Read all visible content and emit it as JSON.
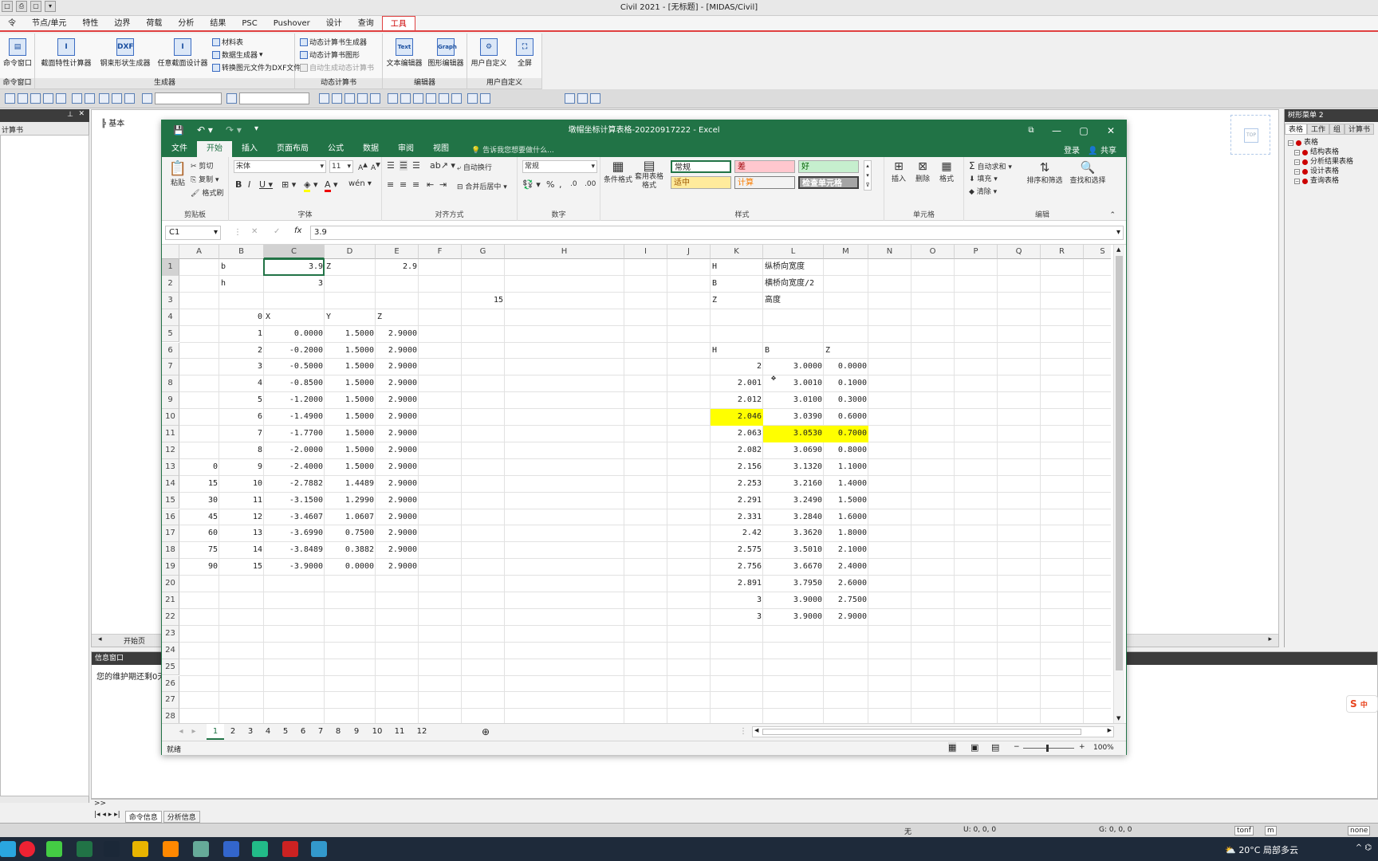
{
  "civil": {
    "title": "Civil 2021 - [无标题] - [MIDAS/Civil]",
    "tabs": [
      "令",
      "节点/单元",
      "特性",
      "边界",
      "荷载",
      "分析",
      "结果",
      "PSC",
      "Pushover",
      "设计",
      "查询",
      "工具"
    ],
    "ribbon": {
      "cmd_window": "命令窗口",
      "cmd_group": "命令窗口",
      "generator_group": "生成器",
      "btn_section_calc": "截面特性计算器",
      "btn_steel_shape": "钢束形状生成器",
      "btn_any_section": "任意截面设计器",
      "btn_material_table": "材料表",
      "btn_data_generator": "数据生成器",
      "btn_to_dxf": "转换图元文件为DXF文件",
      "dyn_group": "动态计算书",
      "btn_dyn_gen": "动态计算书生成器",
      "btn_dyn_graph": "动态计算书图形",
      "btn_auto_dyn": "自动生成动态计算书",
      "editor_group": "编辑器",
      "btn_text_editor": "文本编辑器",
      "btn_graph_editor": "图形编辑器",
      "text_icon": "Text",
      "graph_icon": "Graph",
      "dxf_icon": "DXF",
      "user_group": "用户自定义",
      "btn_user_custom": "用户自定义",
      "btn_fullscreen": "全屏"
    },
    "work_tab": "基本",
    "work_start": "开始页",
    "left_head": "计算书",
    "right_panel": {
      "title": "树形菜单 2",
      "tabs": [
        "表格",
        "工作",
        "组",
        "计算书"
      ],
      "tree": [
        "表格",
        "结构表格",
        "分析结果表格",
        "设计表格",
        "查询表格"
      ]
    },
    "info": {
      "head": "信息窗口",
      "text": "您的维护期还剩0天",
      "tab_cmd": "命令信息",
      "tab_analysis": "分析信息",
      "prompt": ">>"
    },
    "status": {
      "none": "无",
      "u": "U: 0, 0, 0",
      "g": "G: 0, 0, 0",
      "unit_force": "tonf",
      "unit_len": "m",
      "none2": "none"
    }
  },
  "excel": {
    "title": "墩帽坐标计算表格-20220917222 - Excel",
    "tabs": [
      "文件",
      "开始",
      "插入",
      "页面布局",
      "公式",
      "数据",
      "审阅",
      "视图"
    ],
    "tell_me": "告诉我您想要做什么...",
    "login": "登录",
    "share": "共享",
    "clipboard": {
      "paste": "粘贴",
      "cut": "剪切",
      "copy": "复制",
      "format_painter": "格式刷",
      "label": "剪贴板"
    },
    "font": {
      "name": "宋体",
      "size": "11",
      "label": "字体"
    },
    "align": {
      "wrap": "自动换行",
      "merge": "合并后居中",
      "label": "对齐方式"
    },
    "number": {
      "format": "常规",
      "label": "数字"
    },
    "styles": {
      "normal": "常规",
      "bad": "差",
      "good": "好",
      "neutral": "适中",
      "calc": "计算",
      "check": "检查单元格",
      "label": "样式",
      "cond": "条件格式",
      "table": "套用表格格式"
    },
    "cells": {
      "insert": "插入",
      "delete": "删除",
      "format": "格式",
      "label": "单元格"
    },
    "edit": {
      "autosum": "自动求和",
      "fill": "填充",
      "clear": "清除",
      "sort": "排序和筛选",
      "find": "查找和选择",
      "label": "编辑"
    },
    "namebox": "C1",
    "formula": "3.9",
    "columns": [
      "A",
      "B",
      "C",
      "D",
      "E",
      "F",
      "G",
      "H",
      "I",
      "J",
      "K",
      "L",
      "M",
      "N",
      "O",
      "P",
      "Q",
      "R",
      "S"
    ],
    "rows": [
      "1",
      "2",
      "3",
      "4",
      "5",
      "6",
      "7",
      "8",
      "9",
      "10",
      "11",
      "12",
      "13",
      "14",
      "15",
      "16",
      "17",
      "18",
      "19",
      "20",
      "21",
      "22",
      "23",
      "24",
      "25",
      "26",
      "27",
      "28"
    ],
    "cells_data": [
      {
        "r": 1,
        "c": "B",
        "v": "b",
        "a": "l"
      },
      {
        "r": 1,
        "c": "C",
        "v": "3.9",
        "a": "r"
      },
      {
        "r": 1,
        "c": "D",
        "v": "Z",
        "a": "l"
      },
      {
        "r": 1,
        "c": "E",
        "v": "2.9",
        "a": "r"
      },
      {
        "r": 1,
        "c": "K",
        "v": "H",
        "a": "l"
      },
      {
        "r": 1,
        "c": "L",
        "v": "纵桥向宽度",
        "a": "l"
      },
      {
        "r": 2,
        "c": "B",
        "v": "h",
        "a": "l"
      },
      {
        "r": 2,
        "c": "C",
        "v": "3",
        "a": "r"
      },
      {
        "r": 2,
        "c": "K",
        "v": "B",
        "a": "l"
      },
      {
        "r": 2,
        "c": "L",
        "v": "横桥向宽度/2",
        "a": "l"
      },
      {
        "r": 3,
        "c": "G",
        "v": "15",
        "a": "r"
      },
      {
        "r": 3,
        "c": "K",
        "v": "Z",
        "a": "l"
      },
      {
        "r": 3,
        "c": "L",
        "v": "高度",
        "a": "l"
      },
      {
        "r": 4,
        "c": "B",
        "v": "0",
        "a": "r"
      },
      {
        "r": 4,
        "c": "C",
        "v": "X",
        "a": "l"
      },
      {
        "r": 4,
        "c": "D",
        "v": "Y",
        "a": "l"
      },
      {
        "r": 4,
        "c": "E",
        "v": "Z",
        "a": "l"
      },
      {
        "r": 5,
        "c": "B",
        "v": "1",
        "a": "r"
      },
      {
        "r": 5,
        "c": "C",
        "v": "0.0000",
        "a": "r"
      },
      {
        "r": 5,
        "c": "D",
        "v": "1.5000",
        "a": "r"
      },
      {
        "r": 5,
        "c": "E",
        "v": "2.9000",
        "a": "r"
      },
      {
        "r": 6,
        "c": "B",
        "v": "2",
        "a": "r"
      },
      {
        "r": 6,
        "c": "C",
        "v": "-0.2000",
        "a": "r"
      },
      {
        "r": 6,
        "c": "D",
        "v": "1.5000",
        "a": "r"
      },
      {
        "r": 6,
        "c": "E",
        "v": "2.9000",
        "a": "r"
      },
      {
        "r": 6,
        "c": "K",
        "v": "H",
        "a": "l"
      },
      {
        "r": 6,
        "c": "L",
        "v": "B",
        "a": "l"
      },
      {
        "r": 6,
        "c": "M",
        "v": "Z",
        "a": "l"
      },
      {
        "r": 7,
        "c": "B",
        "v": "3",
        "a": "r"
      },
      {
        "r": 7,
        "c": "C",
        "v": "-0.5000",
        "a": "r"
      },
      {
        "r": 7,
        "c": "D",
        "v": "1.5000",
        "a": "r"
      },
      {
        "r": 7,
        "c": "E",
        "v": "2.9000",
        "a": "r"
      },
      {
        "r": 7,
        "c": "K",
        "v": "2",
        "a": "r"
      },
      {
        "r": 7,
        "c": "L",
        "v": "3.0000",
        "a": "r"
      },
      {
        "r": 7,
        "c": "M",
        "v": "0.0000",
        "a": "r"
      },
      {
        "r": 8,
        "c": "B",
        "v": "4",
        "a": "r"
      },
      {
        "r": 8,
        "c": "C",
        "v": "-0.8500",
        "a": "r"
      },
      {
        "r": 8,
        "c": "D",
        "v": "1.5000",
        "a": "r"
      },
      {
        "r": 8,
        "c": "E",
        "v": "2.9000",
        "a": "r"
      },
      {
        "r": 8,
        "c": "K",
        "v": "2.001",
        "a": "r"
      },
      {
        "r": 8,
        "c": "L",
        "v": "3.0010",
        "a": "r"
      },
      {
        "r": 8,
        "c": "M",
        "v": "0.1000",
        "a": "r"
      },
      {
        "r": 9,
        "c": "B",
        "v": "5",
        "a": "r"
      },
      {
        "r": 9,
        "c": "C",
        "v": "-1.2000",
        "a": "r"
      },
      {
        "r": 9,
        "c": "D",
        "v": "1.5000",
        "a": "r"
      },
      {
        "r": 9,
        "c": "E",
        "v": "2.9000",
        "a": "r"
      },
      {
        "r": 9,
        "c": "K",
        "v": "2.012",
        "a": "r"
      },
      {
        "r": 9,
        "c": "L",
        "v": "3.0100",
        "a": "r"
      },
      {
        "r": 9,
        "c": "M",
        "v": "0.3000",
        "a": "r"
      },
      {
        "r": 10,
        "c": "B",
        "v": "6",
        "a": "r"
      },
      {
        "r": 10,
        "c": "C",
        "v": "-1.4900",
        "a": "r"
      },
      {
        "r": 10,
        "c": "D",
        "v": "1.5000",
        "a": "r"
      },
      {
        "r": 10,
        "c": "E",
        "v": "2.9000",
        "a": "r"
      },
      {
        "r": 10,
        "c": "K",
        "v": "2.046",
        "a": "r",
        "hl": true
      },
      {
        "r": 10,
        "c": "L",
        "v": "3.0390",
        "a": "r"
      },
      {
        "r": 10,
        "c": "M",
        "v": "0.6000",
        "a": "r"
      },
      {
        "r": 11,
        "c": "B",
        "v": "7",
        "a": "r"
      },
      {
        "r": 11,
        "c": "C",
        "v": "-1.7700",
        "a": "r"
      },
      {
        "r": 11,
        "c": "D",
        "v": "1.5000",
        "a": "r"
      },
      {
        "r": 11,
        "c": "E",
        "v": "2.9000",
        "a": "r"
      },
      {
        "r": 11,
        "c": "K",
        "v": "2.063",
        "a": "r"
      },
      {
        "r": 11,
        "c": "L",
        "v": "3.0530",
        "a": "r",
        "hl": true
      },
      {
        "r": 11,
        "c": "M",
        "v": "0.7000",
        "a": "r",
        "hl": true
      },
      {
        "r": 12,
        "c": "B",
        "v": "8",
        "a": "r"
      },
      {
        "r": 12,
        "c": "C",
        "v": "-2.0000",
        "a": "r"
      },
      {
        "r": 12,
        "c": "D",
        "v": "1.5000",
        "a": "r"
      },
      {
        "r": 12,
        "c": "E",
        "v": "2.9000",
        "a": "r"
      },
      {
        "r": 12,
        "c": "K",
        "v": "2.082",
        "a": "r"
      },
      {
        "r": 12,
        "c": "L",
        "v": "3.0690",
        "a": "r"
      },
      {
        "r": 12,
        "c": "M",
        "v": "0.8000",
        "a": "r"
      },
      {
        "r": 13,
        "c": "A",
        "v": "0",
        "a": "r"
      },
      {
        "r": 13,
        "c": "B",
        "v": "9",
        "a": "r"
      },
      {
        "r": 13,
        "c": "C",
        "v": "-2.4000",
        "a": "r"
      },
      {
        "r": 13,
        "c": "D",
        "v": "1.5000",
        "a": "r"
      },
      {
        "r": 13,
        "c": "E",
        "v": "2.9000",
        "a": "r"
      },
      {
        "r": 13,
        "c": "K",
        "v": "2.156",
        "a": "r"
      },
      {
        "r": 13,
        "c": "L",
        "v": "3.1320",
        "a": "r"
      },
      {
        "r": 13,
        "c": "M",
        "v": "1.1000",
        "a": "r"
      },
      {
        "r": 14,
        "c": "A",
        "v": "15",
        "a": "r"
      },
      {
        "r": 14,
        "c": "B",
        "v": "10",
        "a": "r"
      },
      {
        "r": 14,
        "c": "C",
        "v": "-2.7882",
        "a": "r"
      },
      {
        "r": 14,
        "c": "D",
        "v": "1.4489",
        "a": "r"
      },
      {
        "r": 14,
        "c": "E",
        "v": "2.9000",
        "a": "r"
      },
      {
        "r": 14,
        "c": "K",
        "v": "2.253",
        "a": "r"
      },
      {
        "r": 14,
        "c": "L",
        "v": "3.2160",
        "a": "r"
      },
      {
        "r": 14,
        "c": "M",
        "v": "1.4000",
        "a": "r"
      },
      {
        "r": 15,
        "c": "A",
        "v": "30",
        "a": "r"
      },
      {
        "r": 15,
        "c": "B",
        "v": "11",
        "a": "r"
      },
      {
        "r": 15,
        "c": "C",
        "v": "-3.1500",
        "a": "r"
      },
      {
        "r": 15,
        "c": "D",
        "v": "1.2990",
        "a": "r"
      },
      {
        "r": 15,
        "c": "E",
        "v": "2.9000",
        "a": "r"
      },
      {
        "r": 15,
        "c": "K",
        "v": "2.291",
        "a": "r"
      },
      {
        "r": 15,
        "c": "L",
        "v": "3.2490",
        "a": "r"
      },
      {
        "r": 15,
        "c": "M",
        "v": "1.5000",
        "a": "r"
      },
      {
        "r": 16,
        "c": "A",
        "v": "45",
        "a": "r"
      },
      {
        "r": 16,
        "c": "B",
        "v": "12",
        "a": "r"
      },
      {
        "r": 16,
        "c": "C",
        "v": "-3.4607",
        "a": "r"
      },
      {
        "r": 16,
        "c": "D",
        "v": "1.0607",
        "a": "r"
      },
      {
        "r": 16,
        "c": "E",
        "v": "2.9000",
        "a": "r"
      },
      {
        "r": 16,
        "c": "K",
        "v": "2.331",
        "a": "r"
      },
      {
        "r": 16,
        "c": "L",
        "v": "3.2840",
        "a": "r"
      },
      {
        "r": 16,
        "c": "M",
        "v": "1.6000",
        "a": "r"
      },
      {
        "r": 17,
        "c": "A",
        "v": "60",
        "a": "r"
      },
      {
        "r": 17,
        "c": "B",
        "v": "13",
        "a": "r"
      },
      {
        "r": 17,
        "c": "C",
        "v": "-3.6990",
        "a": "r"
      },
      {
        "r": 17,
        "c": "D",
        "v": "0.7500",
        "a": "r"
      },
      {
        "r": 17,
        "c": "E",
        "v": "2.9000",
        "a": "r"
      },
      {
        "r": 17,
        "c": "K",
        "v": "2.42",
        "a": "r"
      },
      {
        "r": 17,
        "c": "L",
        "v": "3.3620",
        "a": "r"
      },
      {
        "r": 17,
        "c": "M",
        "v": "1.8000",
        "a": "r"
      },
      {
        "r": 18,
        "c": "A",
        "v": "75",
        "a": "r"
      },
      {
        "r": 18,
        "c": "B",
        "v": "14",
        "a": "r"
      },
      {
        "r": 18,
        "c": "C",
        "v": "-3.8489",
        "a": "r"
      },
      {
        "r": 18,
        "c": "D",
        "v": "0.3882",
        "a": "r"
      },
      {
        "r": 18,
        "c": "E",
        "v": "2.9000",
        "a": "r"
      },
      {
        "r": 18,
        "c": "K",
        "v": "2.575",
        "a": "r"
      },
      {
        "r": 18,
        "c": "L",
        "v": "3.5010",
        "a": "r"
      },
      {
        "r": 18,
        "c": "M",
        "v": "2.1000",
        "a": "r"
      },
      {
        "r": 19,
        "c": "A",
        "v": "90",
        "a": "r"
      },
      {
        "r": 19,
        "c": "B",
        "v": "15",
        "a": "r"
      },
      {
        "r": 19,
        "c": "C",
        "v": "-3.9000",
        "a": "r"
      },
      {
        "r": 19,
        "c": "D",
        "v": "0.0000",
        "a": "r"
      },
      {
        "r": 19,
        "c": "E",
        "v": "2.9000",
        "a": "r"
      },
      {
        "r": 19,
        "c": "K",
        "v": "2.756",
        "a": "r"
      },
      {
        "r": 19,
        "c": "L",
        "v": "3.6670",
        "a": "r"
      },
      {
        "r": 19,
        "c": "M",
        "v": "2.4000",
        "a": "r"
      },
      {
        "r": 20,
        "c": "K",
        "v": "2.891",
        "a": "r"
      },
      {
        "r": 20,
        "c": "L",
        "v": "3.7950",
        "a": "r"
      },
      {
        "r": 20,
        "c": "M",
        "v": "2.6000",
        "a": "r"
      },
      {
        "r": 21,
        "c": "K",
        "v": "3",
        "a": "r"
      },
      {
        "r": 21,
        "c": "L",
        "v": "3.9000",
        "a": "r"
      },
      {
        "r": 21,
        "c": "M",
        "v": "2.7500",
        "a": "r"
      },
      {
        "r": 22,
        "c": "K",
        "v": "3",
        "a": "r"
      },
      {
        "r": 22,
        "c": "L",
        "v": "3.9000",
        "a": "r"
      },
      {
        "r": 22,
        "c": "M",
        "v": "2.9000",
        "a": "r"
      }
    ],
    "sheets": [
      "1",
      "2",
      "3",
      "4",
      "5",
      "6",
      "7",
      "8",
      "9",
      "10",
      "11",
      "12"
    ],
    "status_ready": "就绪",
    "zoom": "100%"
  },
  "taskbar": {
    "weather": "20°C 局部多云",
    "ime": "中"
  }
}
